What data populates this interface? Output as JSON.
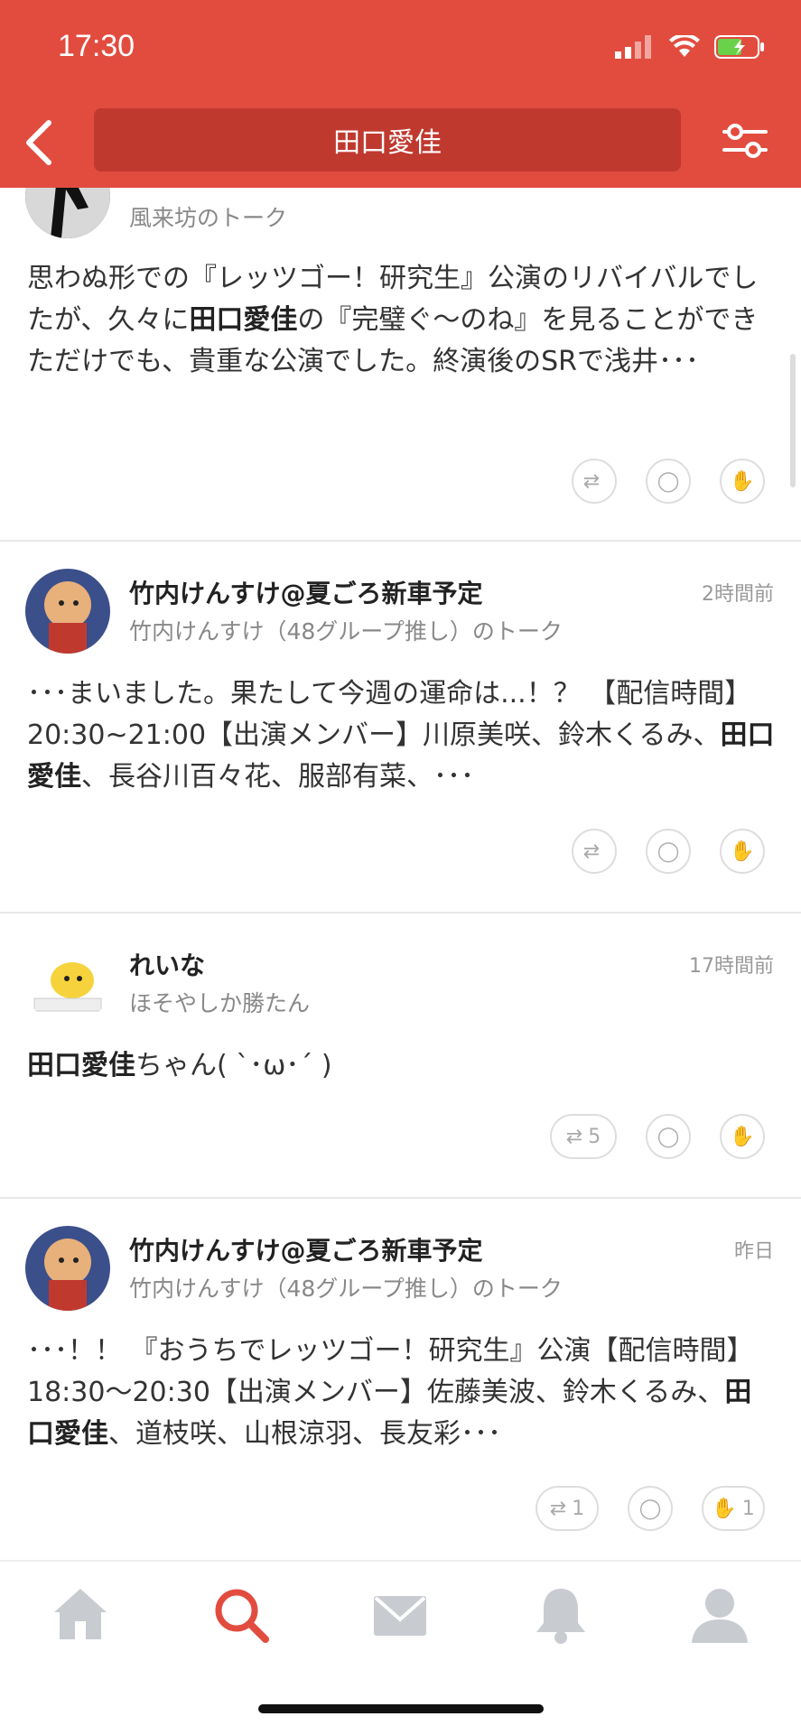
{
  "status_bar": {
    "time": "17:30"
  },
  "header": {
    "search_query": "田口愛佳"
  },
  "posts": [
    {
      "name": "",
      "subtitle": "風来坊のトーク",
      "time_ago": "",
      "body_html": "思わぬ形での『レッツゴー！研究生』公演のリバイバルでしたが、久々に<b>田口愛佳</b>の『完璧ぐ〜のね』を見ることができただけでも、貴重な公演でした。終演後のSRで浅井･･･",
      "counts": {
        "repost": "",
        "comment": "",
        "clap": ""
      }
    },
    {
      "name": "竹内けんすけ@夏ごろ新車予定",
      "subtitle": "竹内けんすけ（48グループ推し）のトーク",
      "time_ago": "2時間前",
      "body_html": "･･･まいました。果たして今週の運命は...！？ 【配信時間】20:30~21:00【出演メンバー】川原美咲、鈴木くるみ、<b>田口愛佳</b>、長谷川百々花、服部有菜、･･･",
      "counts": {
        "repost": "",
        "comment": "",
        "clap": ""
      }
    },
    {
      "name": "れいな",
      "subtitle": "ほそやしか勝たん",
      "time_ago": "17時間前",
      "body_html": "<b>田口愛佳</b>ちゃん( ˋ･ω･ˊ )",
      "counts": {
        "repost": "5",
        "comment": "",
        "clap": ""
      }
    },
    {
      "name": "竹内けんすけ@夏ごろ新車予定",
      "subtitle": "竹内けんすけ（48グループ推し）のトーク",
      "time_ago": "昨日",
      "body_html": "･･･！！ 『おうちでレッツゴー！研究生』公演【配信時間】18:30〜20:30【出演メンバー】佐藤美波、鈴木くるみ、<b>田口愛佳</b>、道枝咲、山根涼羽、長友彩･･･",
      "counts": {
        "repost": "1",
        "comment": "",
        "clap": "1"
      }
    }
  ],
  "tabs": [
    {
      "icon": "home-icon"
    },
    {
      "icon": "search-icon",
      "active": true
    },
    {
      "icon": "mail-icon"
    },
    {
      "icon": "bell-icon"
    },
    {
      "icon": "profile-icon"
    }
  ],
  "colors": {
    "accent": "#e24c3f",
    "search_bg": "#c0392f",
    "icon_gray": "#c8cbd0"
  }
}
